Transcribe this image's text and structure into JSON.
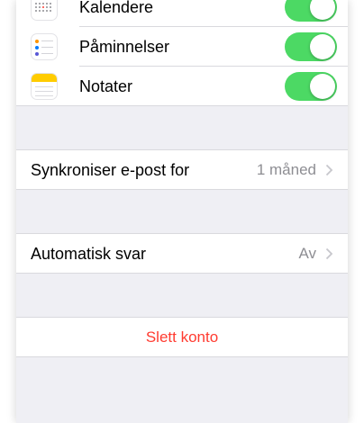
{
  "accounts_apps": {
    "items": [
      {
        "label": "Kalendere",
        "icon": "calendar-icon",
        "enabled": true
      },
      {
        "label": "Påminnelser",
        "icon": "reminders-icon",
        "enabled": true
      },
      {
        "label": "Notater",
        "icon": "notes-icon",
        "enabled": true
      }
    ]
  },
  "mail": {
    "sync_label": "Synkroniser e-post for",
    "sync_value": "1 måned",
    "auto_reply_label": "Automatisk svar",
    "auto_reply_value": "Av"
  },
  "actions": {
    "delete_label": "Slett konto"
  },
  "colors": {
    "toggle_on": "#4cd964",
    "destructive": "#ff3b30",
    "secondary_text": "#8e8e93",
    "grouped_background": "#efeff4"
  }
}
